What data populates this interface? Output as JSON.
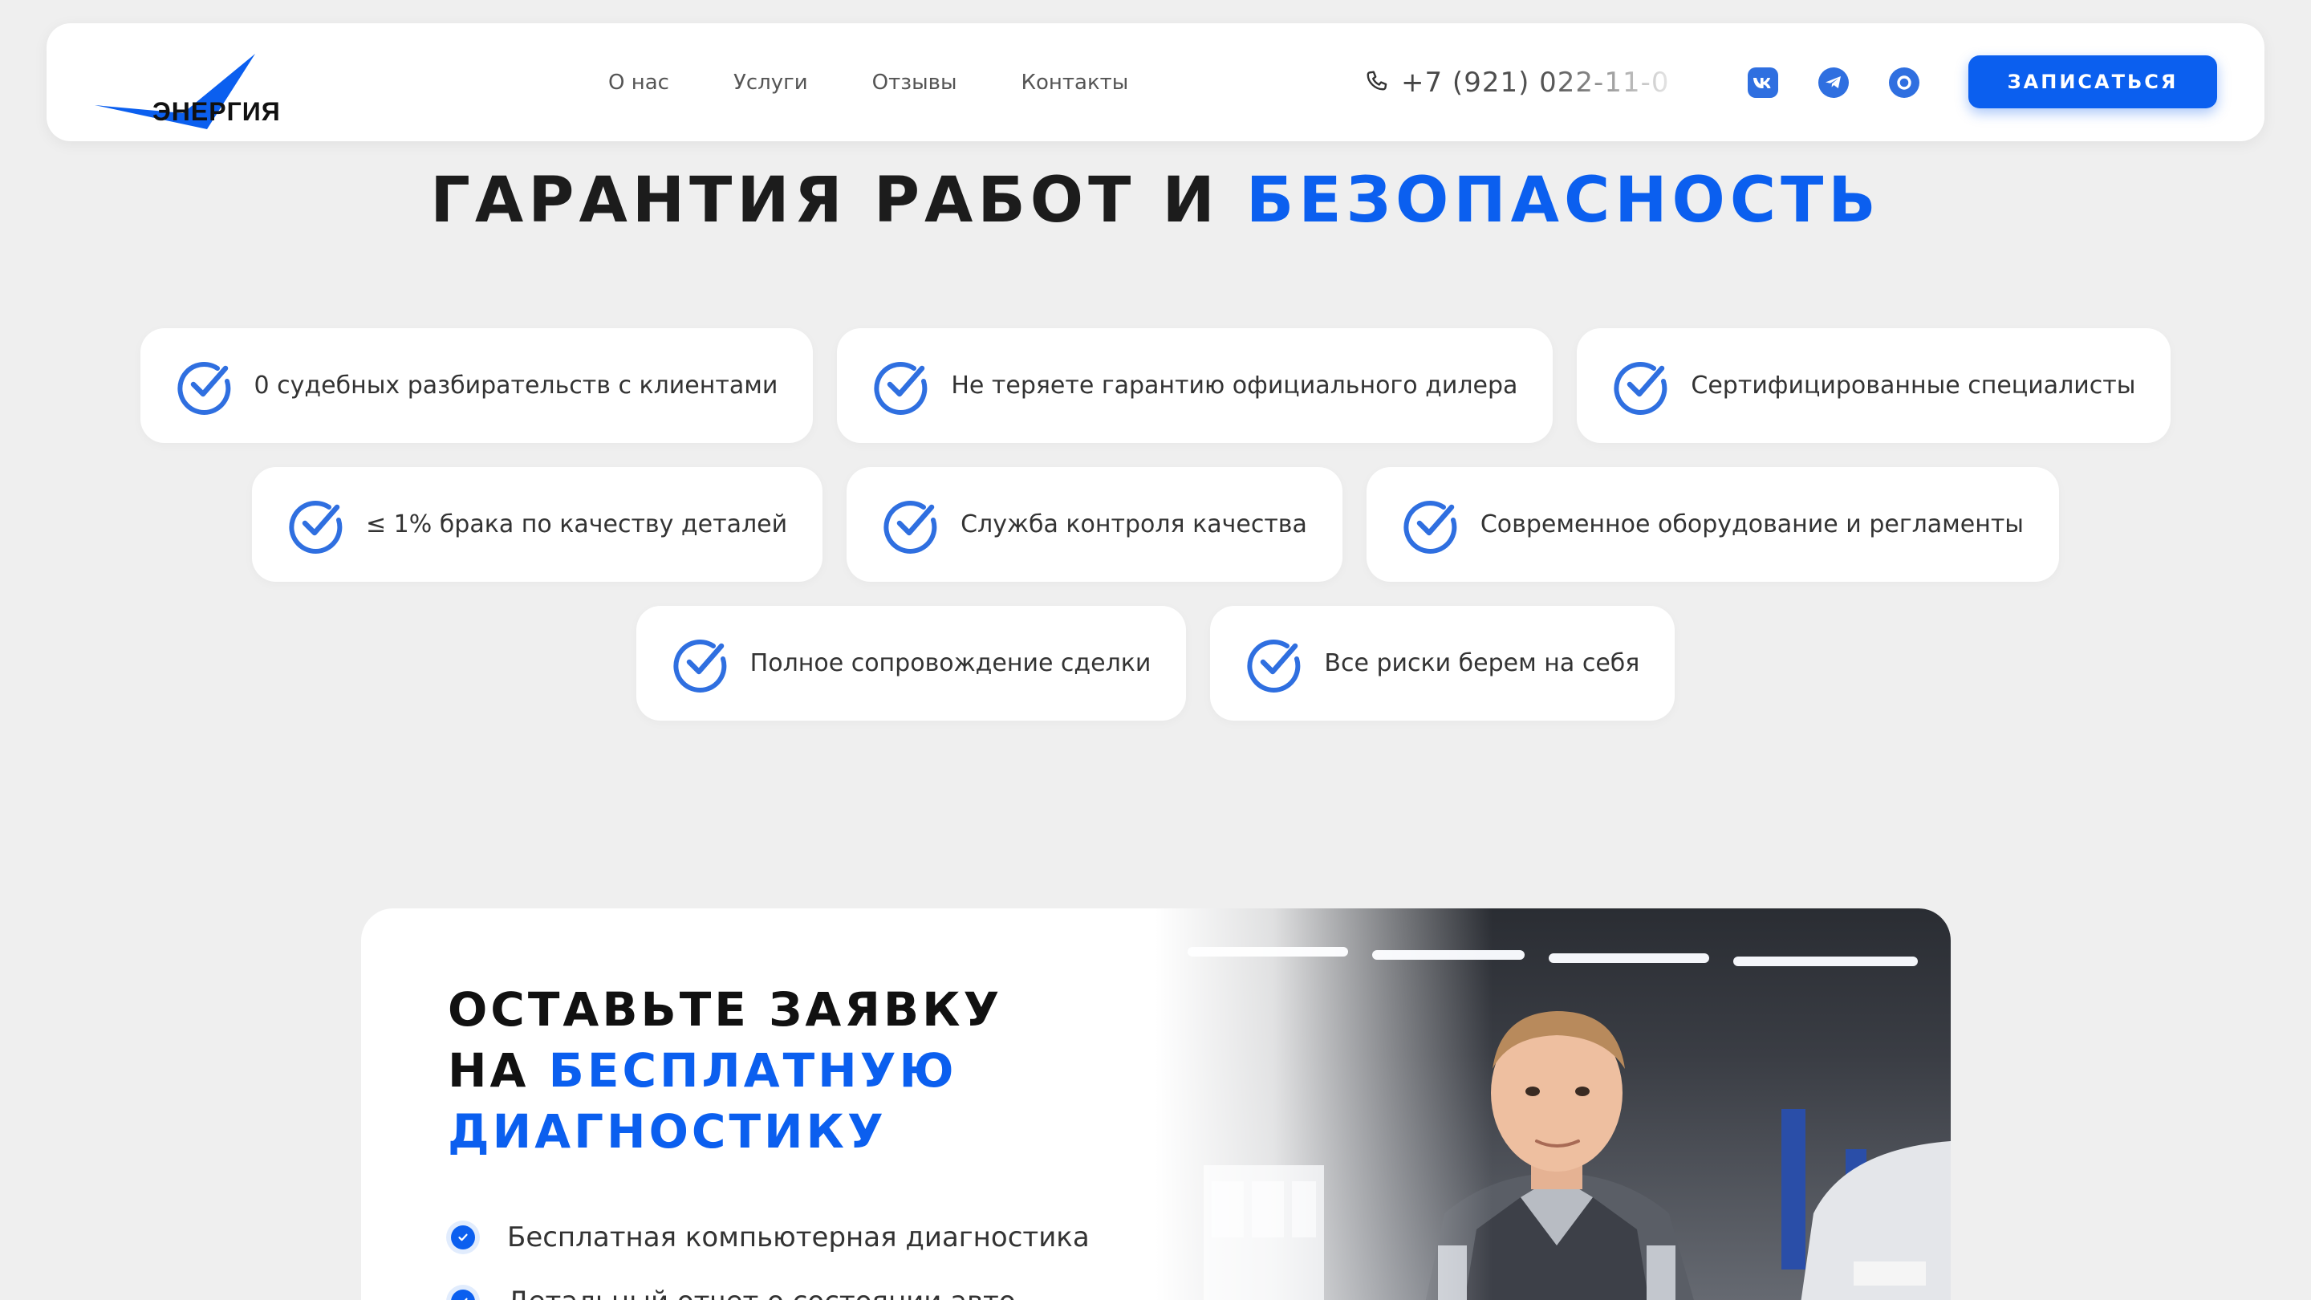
{
  "header": {
    "logo_text": "ЭНЕРГИЯ",
    "nav": [
      {
        "label": "О нас"
      },
      {
        "label": "Услуги"
      },
      {
        "label": "Отзывы"
      },
      {
        "label": "Контакты"
      }
    ],
    "phone": "+7 (921) 022-11-0",
    "socials": [
      {
        "icon": "vk-icon"
      },
      {
        "icon": "telegram-icon"
      },
      {
        "icon": "max-messenger-icon"
      }
    ],
    "cta_label": "ЗАПИСАТЬСЯ"
  },
  "guarantee": {
    "title_main": "ГАРАНТИЯ РАБОТ И ",
    "title_accent": "БЕЗОПАСНОСТЬ",
    "items": [
      "0 судебных разбирательств с клиентами",
      "Не теряете гарантию официального дилера",
      "Сертифицированные специалисты",
      "≤ 1% брака по качеству деталей",
      "Служба контроля качества",
      "Современное оборудование и регламенты",
      "Полное сопровождение сделки",
      "Все риски берем на себя"
    ]
  },
  "request": {
    "title_line1": "ОСТАВЬТЕ ЗАЯВКУ",
    "title_line2_main": "НА ",
    "title_line2_accent": "БЕСПЛАТНУЮ",
    "title_line3_accent": "ДИАГНОСТИКУ",
    "benefits": [
      "Бесплатная компьютерная диагностика",
      "Детальный отчет о состоянии авто"
    ]
  },
  "colors": {
    "accent": "#0b5fef",
    "check": "#2f6fe0",
    "background": "#efefef"
  }
}
